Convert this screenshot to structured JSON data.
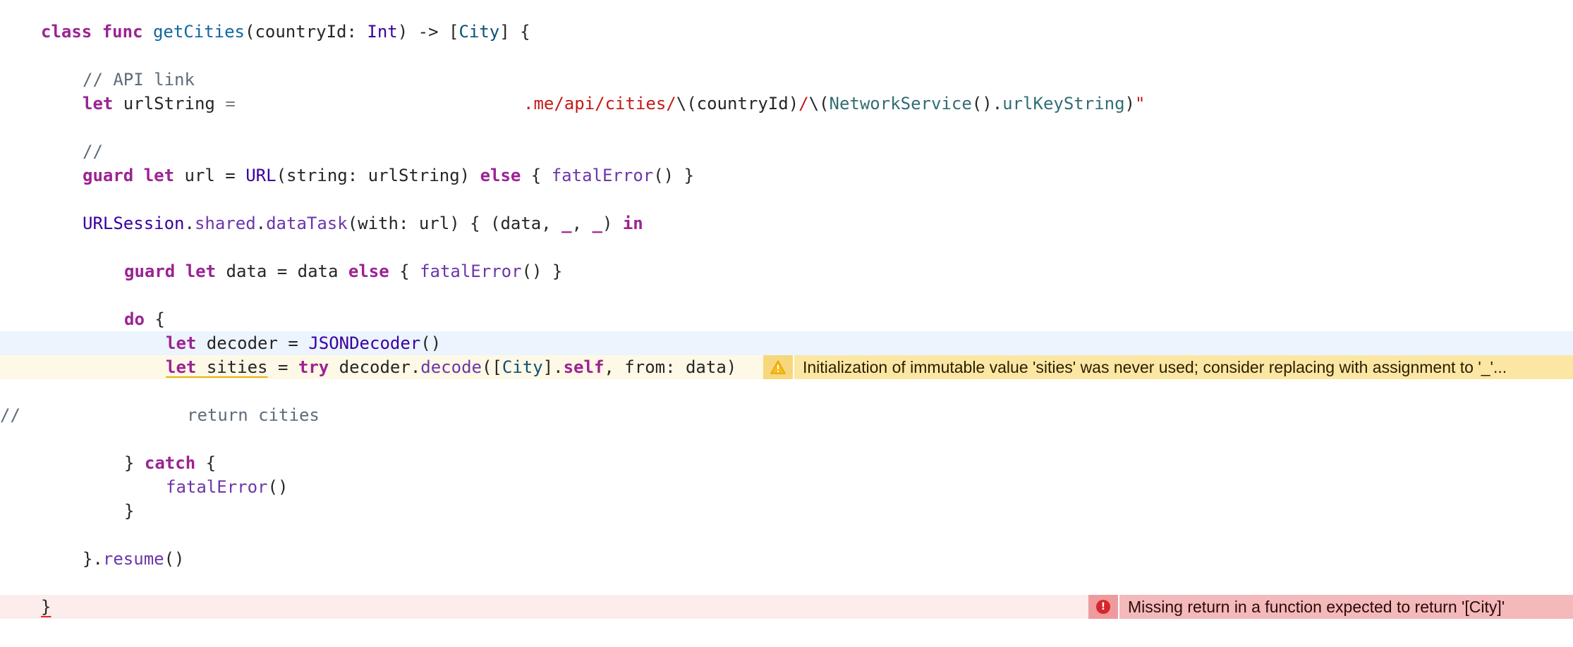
{
  "colors": {
    "keyword": "#9b2393",
    "function_name": "#3900a0",
    "type": "#0b4f79",
    "string": "#c41a16",
    "comment": "#5d6c79",
    "warning_background": "#fbe6a4",
    "error_background": "#f4b9ba",
    "current_line": "#ecf4fd"
  },
  "icons": {
    "warning": "warning-triangle-icon",
    "error": "error-circle-icon"
  },
  "code": {
    "l1": {
      "kw1": "class",
      "kw2": "func",
      "name": "getCities",
      "p1": "(countryId: ",
      "type1": "Int",
      "p2": ") -> [",
      "type2": "City",
      "p3": "] {"
    },
    "l2": {
      "comment": "// API link"
    },
    "l3": {
      "kw": "let",
      "p1": " urlString ",
      "eq": "=",
      "str1": ".me/api/cities/",
      "p2": "\\(countryId)",
      "str2": "/",
      "p3": "\\(",
      "type": "NetworkService",
      "p4": "().",
      "ident": "urlKeyString",
      "p5": ")",
      "quote": "\""
    },
    "l4": {
      "comment": "//"
    },
    "l5": {
      "kw1": "guard",
      "kw2": "let",
      "p1": " url = ",
      "type": "URL",
      "p2": "(string: urlString) ",
      "kw3": "else",
      "p3": " { ",
      "fn": "fatalError",
      "p4": "() }"
    },
    "l6": {
      "type": "URLSession",
      "p1": ".",
      "prop1": "shared",
      "p2": ".",
      "prop2": "dataTask",
      "p3": "(with: url) { (data, ",
      "u1": "_",
      "p4": ", ",
      "u2": "_",
      "p5": ") ",
      "kw": "in"
    },
    "l7": {
      "kw1": "guard",
      "kw2": "let",
      "p1": " data = data ",
      "kw3": "else",
      "p2": " { ",
      "fn": "fatalError",
      "p3": "() }"
    },
    "l8": {
      "kw": "do",
      "p1": " {"
    },
    "l9": {
      "kw": "let",
      "p1": " decoder = ",
      "type": "JSONDecoder",
      "p2": "()"
    },
    "l10": {
      "kw": "let",
      "p1": " ",
      "var": "sities",
      "p2": " = ",
      "kw2": "try",
      "p3": " decoder.",
      "prop": "decode",
      "p4": "([",
      "type": "City",
      "p5": "].",
      "kw3": "self",
      "p6": ", from: data)"
    },
    "l11": {
      "slashes": "//",
      "comment": "return cities"
    },
    "l12": {
      "p1": "} ",
      "kw": "catch",
      "p2": " {"
    },
    "l13": {
      "fn": "fatalError",
      "p1": "()"
    },
    "l14": {
      "p1": "}"
    },
    "l15": {
      "p1": "}.",
      "prop": "resume",
      "p2": "()"
    },
    "l16": {
      "brace": "}"
    }
  },
  "diagnostics": {
    "warning": {
      "message": "Initialization of immutable value 'sities' was never used; consider replacing with assignment to '_'..."
    },
    "error": {
      "glyph": "!",
      "message": "Missing return in a function expected to return '[City]'"
    }
  }
}
